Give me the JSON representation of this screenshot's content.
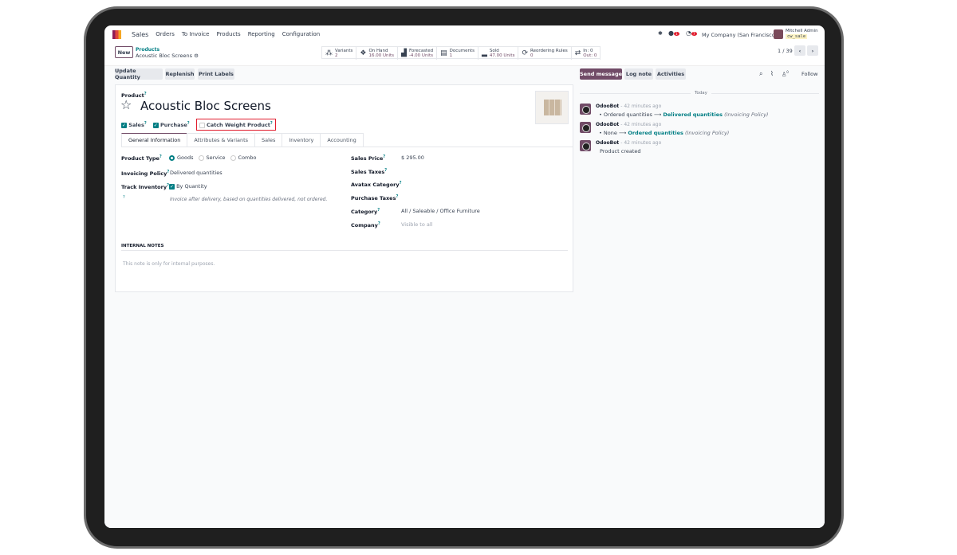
{
  "nav": {
    "app": "Sales",
    "menu": [
      "Orders",
      "To Invoice",
      "Products",
      "Reporting",
      "Configuration"
    ],
    "company": "My Company (San Francisco)",
    "user": "Mitchell Admin",
    "db": "cw_sale",
    "messages_badge": "1",
    "activities_badge": "7"
  },
  "breadcrumb": {
    "new": "New",
    "parent": "Products",
    "current": "Acoustic Bloc Screens"
  },
  "stats": [
    {
      "icon": "variants-icon",
      "glyph": "⁂",
      "label": "Variants",
      "value": "2"
    },
    {
      "icon": "cubes-icon",
      "glyph": "❖",
      "label": "On Hand",
      "value": "16.00 Units"
    },
    {
      "icon": "area-chart-icon",
      "glyph": "▟",
      "label": "Forecasted",
      "value": "-4.00 Units"
    },
    {
      "icon": "document-icon",
      "glyph": "▤",
      "label": "Documents",
      "value": "1"
    },
    {
      "icon": "signal-icon",
      "glyph": "▂",
      "label": "Sold",
      "value": "47.00 Units"
    },
    {
      "icon": "refresh-icon",
      "glyph": "⟳",
      "label": "Reordering Rules",
      "value": "0"
    },
    {
      "icon": "exchange-icon",
      "glyph": "⇄",
      "label": "In: 0",
      "value": "Out: 0"
    }
  ],
  "pager": "1 / 39",
  "actions": [
    "Update Quantity",
    "Replenish",
    "Print Labels"
  ],
  "chatter_actions": {
    "send": "Send message",
    "log": "Log note",
    "activities": "Activities",
    "follow": "Follow",
    "followers": "0"
  },
  "product": {
    "label": "Product",
    "name": "Acoustic Bloc Screens",
    "sales": "Sales",
    "purchase": "Purchase",
    "catch_weight": "Catch Weight Product",
    "highlight_color": "#e11d2e"
  },
  "tabs": [
    "General Information",
    "Attributes & Variants",
    "Sales",
    "Inventory",
    "Accounting"
  ],
  "form": {
    "product_type": "Product Type",
    "types": [
      "Goods",
      "Service",
      "Combo"
    ],
    "invoicing_policy": "Invoicing Policy",
    "invoicing_value": "Delivered quantities",
    "track_inventory": "Track Inventory",
    "track_value": "By Quantity",
    "hint": "Invoice after delivery, based on quantities delivered, not ordered.",
    "sales_price": "Sales Price",
    "sales_price_value": "$ 295.00",
    "sales_taxes": "Sales Taxes",
    "avatax": "Avatax Category",
    "purchase_taxes": "Purchase Taxes",
    "category": "Category",
    "category_value": "All / Saleable / Office Furniture",
    "company": "Company",
    "company_value": "Visible to all",
    "notes_title": "INTERNAL NOTES",
    "notes_placeholder": "This note is only for internal purposes."
  },
  "chatter": {
    "today": "Today",
    "messages": [
      {
        "author": "OdooBot",
        "time": "- 42 minutes ago",
        "old": "Ordered quantities",
        "new": "Delivered quantities",
        "field": "(Invoicing Policy)"
      },
      {
        "author": "OdooBot",
        "time": "- 42 minutes ago",
        "old": "None",
        "new": "Ordered quantities",
        "field": "(Invoicing Policy)"
      },
      {
        "author": "OdooBot",
        "time": "- 42 minutes ago",
        "text": "Product created"
      }
    ]
  }
}
